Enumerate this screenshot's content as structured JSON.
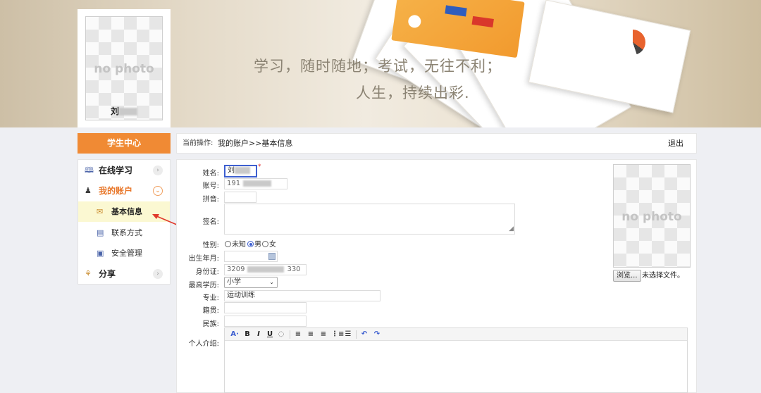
{
  "banner": {
    "slogan_line1": "学习，随时随地；考试，无往不利；",
    "slogan_line2": "人生，持续出彩."
  },
  "avatar": {
    "placeholder_text": "no photo",
    "user_name": "刘"
  },
  "sidebar": {
    "header": "学生中心",
    "items": [
      {
        "label": "在线学习",
        "icon": "book-icon",
        "expanded": false
      },
      {
        "label": "我的账户",
        "icon": "user-icon",
        "expanded": true,
        "children": [
          {
            "label": "基本信息",
            "icon": "profile-card-icon",
            "selected": true
          },
          {
            "label": "联系方式",
            "icon": "contact-card-icon",
            "selected": false
          },
          {
            "label": "安全管理",
            "icon": "security-icon",
            "selected": false
          }
        ]
      },
      {
        "label": "分享",
        "icon": "share-icon",
        "expanded": false
      }
    ]
  },
  "breadcrumb": {
    "prefix": "当前操作:",
    "path": "我的账户>>基本信息",
    "logout": "退出"
  },
  "form": {
    "name": {
      "label": "姓名:",
      "value": "刘",
      "required_mark": "*"
    },
    "account": {
      "label": "账号:",
      "value": "191"
    },
    "pinyin": {
      "label": "拼音:",
      "value": ""
    },
    "signature": {
      "label": "签名:",
      "value": ""
    },
    "gender": {
      "label": "性别:",
      "options": [
        "未知",
        "男",
        "女"
      ],
      "selected": "男"
    },
    "birth": {
      "label": "出生年月:",
      "value": ""
    },
    "id_card": {
      "label": "身份证:",
      "value_start": "3209",
      "value_end": "330"
    },
    "education": {
      "label": "最高学历:",
      "selected": "小学"
    },
    "major": {
      "label": "专业:",
      "value": "运动训练"
    },
    "native_place": {
      "label": "籍贯:",
      "value": ""
    },
    "ethnicity": {
      "label": "民族:",
      "value": ""
    },
    "intro": {
      "label": "个人介绍:",
      "value": ""
    }
  },
  "editor_toolbar": [
    "A·",
    "B",
    "I",
    "U",
    "◌",
    "≡",
    "≡",
    "≡",
    "⋮≡",
    "☰",
    "↶",
    "↷"
  ],
  "photo_upload": {
    "placeholder_text": "no photo",
    "browse_label": "浏览...",
    "file_status": "未选择文件。"
  },
  "colors": {
    "accent": "#f08a34",
    "focus": "#3d5fd0",
    "selected_bg": "#fbf8d2",
    "annotation_arrow": "#e0392b"
  }
}
